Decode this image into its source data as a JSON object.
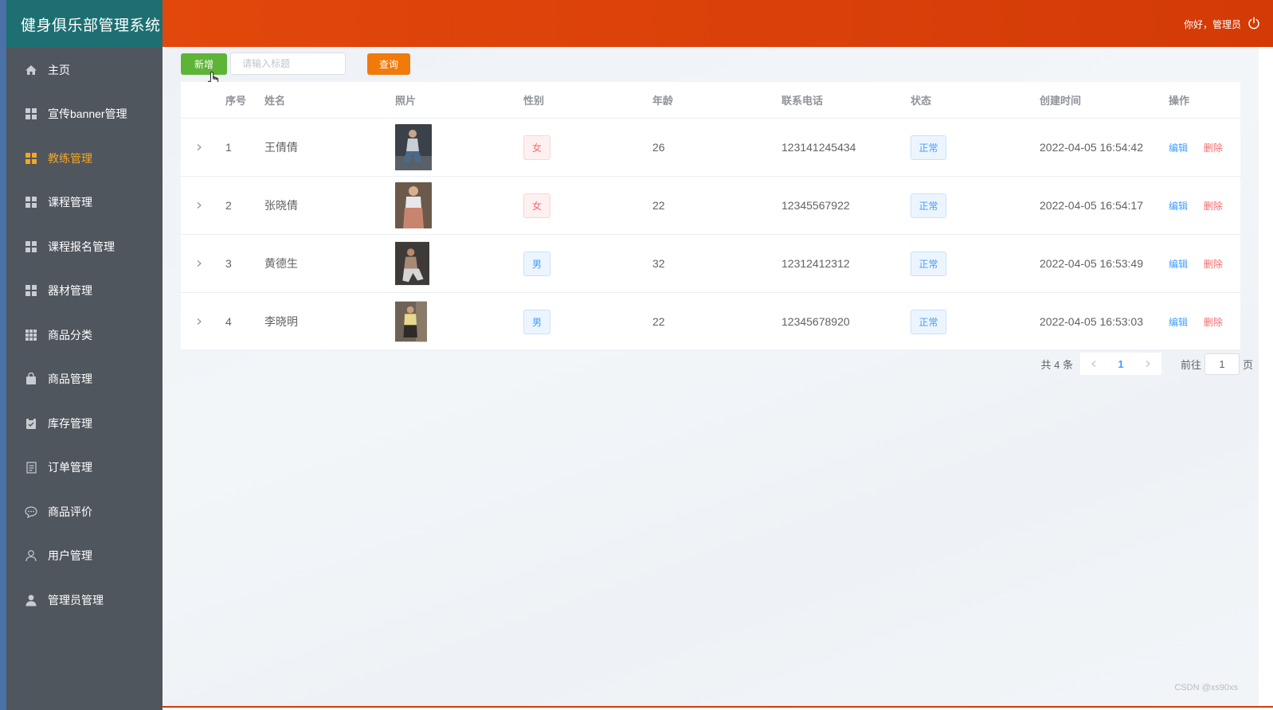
{
  "app": {
    "title": "健身俱乐部管理系统"
  },
  "header": {
    "greeting": "你好，管理员"
  },
  "sidebar": {
    "items": [
      {
        "label": "主页",
        "icon": "home-icon"
      },
      {
        "label": "宣传banner管理",
        "icon": "grid-icon"
      },
      {
        "label": "教练管理",
        "icon": "grid-icon",
        "active": true
      },
      {
        "label": "课程管理",
        "icon": "grid-icon"
      },
      {
        "label": "课程报名管理",
        "icon": "grid-icon"
      },
      {
        "label": "器材管理",
        "icon": "grid-icon"
      },
      {
        "label": "商品分类",
        "icon": "apps-icon"
      },
      {
        "label": "商品管理",
        "icon": "bag-icon"
      },
      {
        "label": "库存管理",
        "icon": "clipboard-icon"
      },
      {
        "label": "订单管理",
        "icon": "document-icon"
      },
      {
        "label": "商品评价",
        "icon": "chat-icon"
      },
      {
        "label": "用户管理",
        "icon": "user-outline-icon"
      },
      {
        "label": "管理员管理",
        "icon": "user-solid-icon"
      }
    ]
  },
  "toolbar": {
    "add_label": "新增",
    "search_placeholder": "请输入标题",
    "search_label": "查询"
  },
  "table": {
    "headers": {
      "index": "序号",
      "name": "姓名",
      "photo": "照片",
      "gender": "性别",
      "age": "年龄",
      "phone": "联系电话",
      "status": "状态",
      "created": "创建时间",
      "actions": "操作"
    },
    "rows": [
      {
        "index": "1",
        "name": "王倩倩",
        "gender": "女",
        "age": "26",
        "phone": "123141245434",
        "status": "正常",
        "created": "2022-04-05 16:54:42",
        "edit": "编辑",
        "delete": "删除"
      },
      {
        "index": "2",
        "name": "张晓倩",
        "gender": "女",
        "age": "22",
        "phone": "12345567922",
        "status": "正常",
        "created": "2022-04-05 16:54:17",
        "edit": "编辑",
        "delete": "删除"
      },
      {
        "index": "3",
        "name": "黄德生",
        "gender": "男",
        "age": "32",
        "phone": "12312412312",
        "status": "正常",
        "created": "2022-04-05 16:53:49",
        "edit": "编辑",
        "delete": "删除"
      },
      {
        "index": "4",
        "name": "李晓明",
        "gender": "男",
        "age": "22",
        "phone": "12345678920",
        "status": "正常",
        "created": "2022-04-05 16:53:03",
        "edit": "编辑",
        "delete": "删除"
      }
    ]
  },
  "pagination": {
    "total": "共 4 条",
    "current": "1",
    "goto_label": "前往",
    "goto_value": "1",
    "page_suffix": "页"
  },
  "watermark": "CSDN @xs90xs",
  "colors": {
    "brand": "#1d6f72",
    "header": "#d9400a",
    "sidebar": "#50565e",
    "active": "#f5a623",
    "add_button": "#5eb437",
    "search_button": "#f07b0a"
  }
}
